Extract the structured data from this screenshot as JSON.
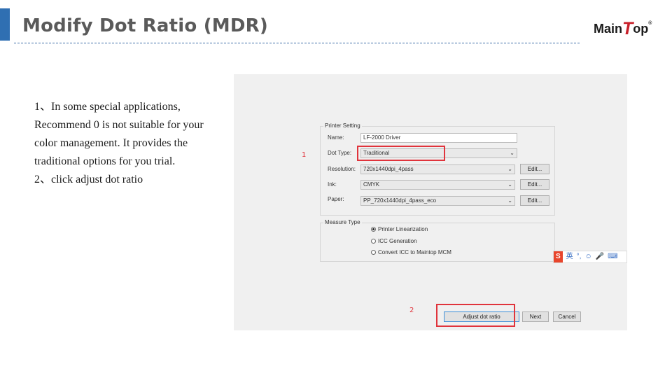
{
  "slide": {
    "title": "Modify Dot Ratio (MDR)",
    "logo": {
      "part1": "Main",
      "part2": "T",
      "part3": "op",
      "reg": "®"
    },
    "body_lines": [
      "1、In some special applications, Recommend 0 is not suitable for your color management. It provides the traditional options for you trial.",
      "2、click adjust dot ratio"
    ]
  },
  "dialog": {
    "printer_setting": {
      "group_title": "Printer Setting",
      "name_label": "Name:",
      "name_value": "LF-2000 Driver",
      "dot_type_label": "Dot Type:",
      "dot_type_value": "Traditional",
      "resolution_label": "Resolution:",
      "resolution_value": "720x1440dpi_4pass",
      "ink_label": "Ink:",
      "ink_value": "CMYK",
      "paper_label": "Paper:",
      "paper_value": "PP_720x1440dpi_4pass_eco",
      "edit_label": "Edit..."
    },
    "measure_type": {
      "group_title": "Measure Type",
      "options": [
        {
          "label": "Printer Linearization",
          "selected": true
        },
        {
          "label": "ICC Generation",
          "selected": false
        },
        {
          "label": "Convert ICC to Maintop MCM",
          "selected": false
        }
      ]
    },
    "buttons": {
      "adjust_dot_ratio": "Adjust dot ratio",
      "next": "Next",
      "cancel": "Cancel"
    },
    "ime_toolbar": {
      "logo": "S",
      "lang": "英",
      "punct": "°,",
      "emoji": "☺",
      "mic": "🎤",
      "keyboard": "⌨"
    }
  },
  "annotations": {
    "marker_1": "1",
    "marker_2": "2"
  },
  "colors": {
    "accent": "#2f6fb2",
    "highlight": "#e0343c",
    "logo_red": "#c8202a"
  }
}
